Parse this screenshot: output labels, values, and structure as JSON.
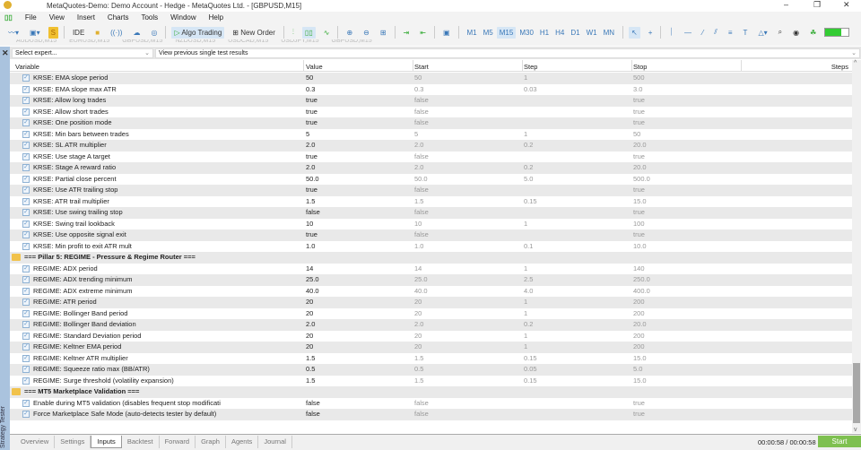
{
  "window": {
    "title": "MetaQuotes-Demo: Demo Account - Hedge - MetaQuotes Ltd. - [GBPUSD,M15]",
    "minimize": "–",
    "restore": "❐",
    "close": "✕"
  },
  "menu": [
    "File",
    "View",
    "Insert",
    "Charts",
    "Tools",
    "Window",
    "Help"
  ],
  "toolbar": {
    "ide": "IDE",
    "algo_trading": "Algo Trading",
    "new_order": "New Order",
    "timeframes": [
      "M1",
      "M5",
      "M15",
      "M30",
      "H1",
      "H4",
      "D1",
      "W1",
      "MN"
    ],
    "active_timeframe": "M15"
  },
  "chart_tabs": [
    "AUDUSD,M15",
    "EURUSD,M15",
    "GBPUSD,M15",
    "NZDUSD,M15",
    "USDCAD,M15",
    "USDJPY,M15",
    "GBPUSD,M15"
  ],
  "tester": {
    "side_label": "Strategy Tester",
    "expert_select": "Select expert...",
    "results_select": "View previous single test results"
  },
  "columns": {
    "variable": "Variable",
    "value": "Value",
    "start": "Start",
    "step": "Step",
    "stop": "Stop",
    "steps": "Steps"
  },
  "rows": [
    {
      "name": "KRSE: EMA slope period",
      "value": "50",
      "start": "50",
      "step": "1",
      "stop": "500"
    },
    {
      "name": "KRSE: EMA slope max ATR",
      "value": "0.3",
      "start": "0.3",
      "step": "0.03",
      "stop": "3.0"
    },
    {
      "name": "KRSE: Allow long trades",
      "value": "true",
      "start": "false",
      "step": "",
      "stop": "true"
    },
    {
      "name": "KRSE: Allow short trades",
      "value": "true",
      "start": "false",
      "step": "",
      "stop": "true"
    },
    {
      "name": "KRSE: One position mode",
      "value": "true",
      "start": "false",
      "step": "",
      "stop": "true"
    },
    {
      "name": "KRSE: Min bars between trades",
      "value": "5",
      "start": "5",
      "step": "1",
      "stop": "50"
    },
    {
      "name": "KRSE: SL ATR multiplier",
      "value": "2.0",
      "start": "2.0",
      "step": "0.2",
      "stop": "20.0"
    },
    {
      "name": "KRSE: Use stage A target",
      "value": "true",
      "start": "false",
      "step": "",
      "stop": "true"
    },
    {
      "name": "KRSE: Stage A reward ratio",
      "value": "2.0",
      "start": "2.0",
      "step": "0.2",
      "stop": "20.0"
    },
    {
      "name": "KRSE: Partial close percent",
      "value": "50.0",
      "start": "50.0",
      "step": "5.0",
      "stop": "500.0"
    },
    {
      "name": "KRSE: Use ATR trailing stop",
      "value": "true",
      "start": "false",
      "step": "",
      "stop": "true"
    },
    {
      "name": "KRSE: ATR trail multiplier",
      "value": "1.5",
      "start": "1.5",
      "step": "0.15",
      "stop": "15.0"
    },
    {
      "name": "KRSE: Use swing trailing stop",
      "value": "false",
      "start": "false",
      "step": "",
      "stop": "true"
    },
    {
      "name": "KRSE: Swing trail lookback",
      "value": "10",
      "start": "10",
      "step": "1",
      "stop": "100"
    },
    {
      "name": "KRSE: Use opposite signal exit",
      "value": "true",
      "start": "false",
      "step": "",
      "stop": "true"
    },
    {
      "name": "KRSE: Min profit to exit ATR mult",
      "value": "1.0",
      "start": "1.0",
      "step": "0.1",
      "stop": "10.0"
    },
    {
      "group": true,
      "name": "=== Pillar 5: REGIME - Pressure & Regime Router ==="
    },
    {
      "name": "REGIME: ADX period",
      "value": "14",
      "start": "14",
      "step": "1",
      "stop": "140"
    },
    {
      "name": "REGIME: ADX trending minimum",
      "value": "25.0",
      "start": "25.0",
      "step": "2.5",
      "stop": "250.0"
    },
    {
      "name": "REGIME: ADX extreme minimum",
      "value": "40.0",
      "start": "40.0",
      "step": "4.0",
      "stop": "400.0"
    },
    {
      "name": "REGIME: ATR period",
      "value": "20",
      "start": "20",
      "step": "1",
      "stop": "200"
    },
    {
      "name": "REGIME: Bollinger Band period",
      "value": "20",
      "start": "20",
      "step": "1",
      "stop": "200"
    },
    {
      "name": "REGIME: Bollinger Band deviation",
      "value": "2.0",
      "start": "2.0",
      "step": "0.2",
      "stop": "20.0"
    },
    {
      "name": "REGIME: Standard Deviation period",
      "value": "20",
      "start": "20",
      "step": "1",
      "stop": "200"
    },
    {
      "name": "REGIME: Keltner EMA period",
      "value": "20",
      "start": "20",
      "step": "1",
      "stop": "200"
    },
    {
      "name": "REGIME: Keltner ATR multiplier",
      "value": "1.5",
      "start": "1.5",
      "step": "0.15",
      "stop": "15.0"
    },
    {
      "name": "REGIME: Squeeze ratio max (BB/ATR)",
      "value": "0.5",
      "start": "0.5",
      "step": "0.05",
      "stop": "5.0"
    },
    {
      "name": "REGIME: Surge threshold (volatility expansion)",
      "value": "1.5",
      "start": "1.5",
      "step": "0.15",
      "stop": "15.0"
    },
    {
      "group": true,
      "name": "=== MT5 Marketplace Validation ==="
    },
    {
      "name": "Enable during MT5 validation (disables frequent stop modificati",
      "value": "false",
      "start": "false",
      "step": "",
      "stop": "true"
    },
    {
      "name": "Force Marketplace Safe Mode (auto-detects tester by default)",
      "value": "false",
      "start": "false",
      "step": "",
      "stop": "true"
    }
  ],
  "bottom_tabs": [
    "Overview",
    "Settings",
    "Inputs",
    "Backtest",
    "Forward",
    "Graph",
    "Agents",
    "Journal"
  ],
  "active_tab": "Inputs",
  "status": {
    "time": "00:00:58 / 00:00:58",
    "start_button": "Start"
  }
}
